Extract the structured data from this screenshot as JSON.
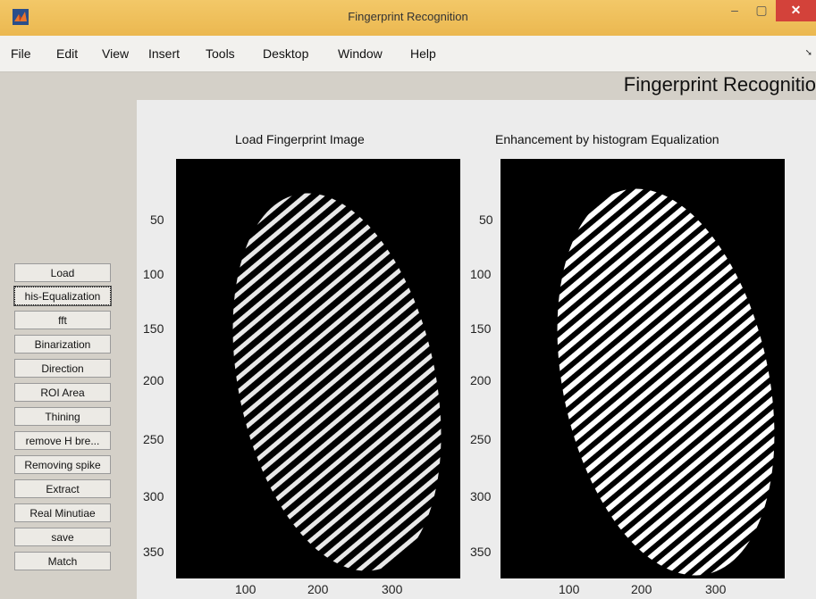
{
  "window": {
    "title": "Fingerprint Recognition",
    "close_label": "✕",
    "max_label": "▢",
    "min_label": "–"
  },
  "menu": [
    "File",
    "Edit",
    "View",
    "Insert",
    "Tools",
    "Desktop",
    "Window",
    "Help"
  ],
  "figure": {
    "title": "Fingerprint Recognitio"
  },
  "axes": [
    {
      "title": "Load Fingerprint Image"
    },
    {
      "title": "Enhancement by histogram Equalization"
    }
  ],
  "y_ticks": [
    "50",
    "100",
    "150",
    "200",
    "250",
    "300",
    "350"
  ],
  "x_ticks": [
    "100",
    "200",
    "300"
  ],
  "buttons": [
    "Load",
    "his-Equalization",
    "fft",
    "Binarization",
    "Direction",
    "ROI Area",
    "Thining",
    "remove H bre...",
    "Removing spike",
    "Extract",
    "Real Minutiae",
    "save",
    "Match"
  ],
  "colors": {
    "titlebar": "#f0c35a",
    "close": "#d3423a",
    "background": "#d4d0c8"
  }
}
